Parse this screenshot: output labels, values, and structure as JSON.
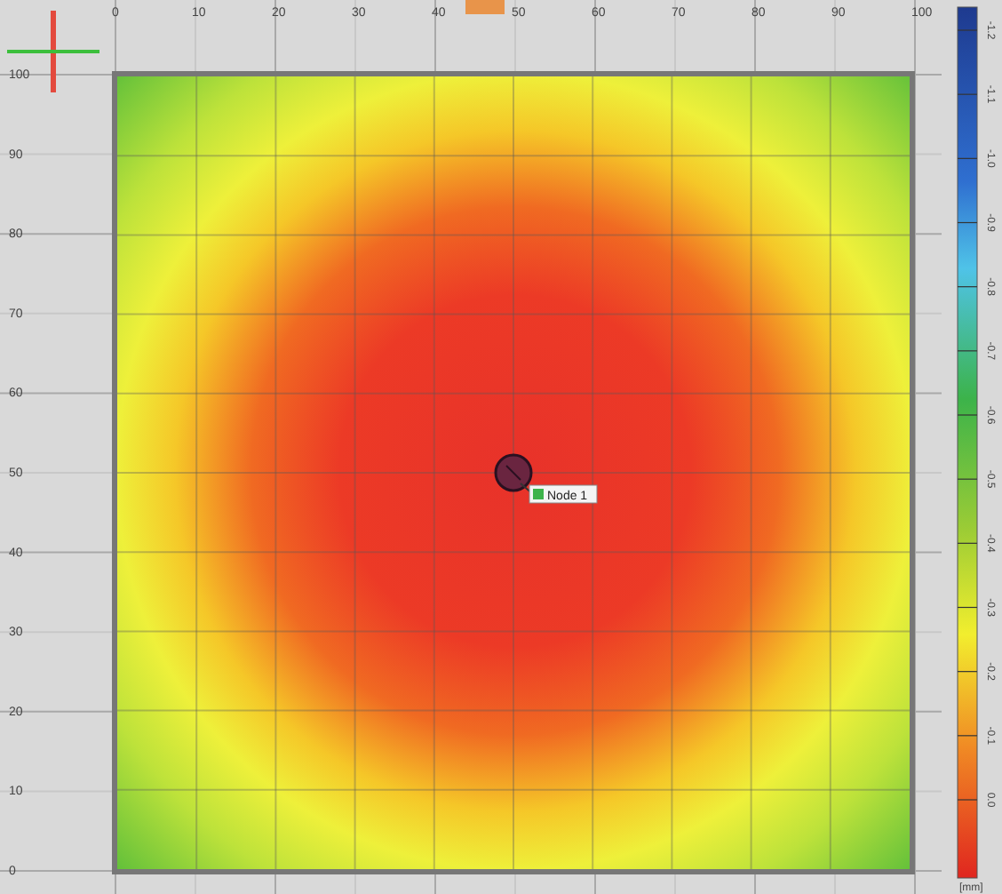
{
  "x_axis": {
    "ticks": [
      "0",
      "10",
      "20",
      "30",
      "40",
      "50",
      "60",
      "70",
      "80",
      "90",
      "100"
    ]
  },
  "y_axis": {
    "ticks": [
      "100",
      "90",
      "80",
      "70",
      "60",
      "50",
      "40",
      "30",
      "20",
      "10",
      "0"
    ]
  },
  "marker": {
    "label": "Node 1"
  },
  "colorbar": {
    "ticks": [
      "-1.2",
      "-1.1",
      "-1.0",
      "-0.9",
      "-0.8",
      "-0.7",
      "-0.6",
      "-0.5",
      "-0.4",
      "-0.3",
      "-0.2",
      "-0.1",
      "0.0"
    ],
    "unit": "[mm]"
  }
}
